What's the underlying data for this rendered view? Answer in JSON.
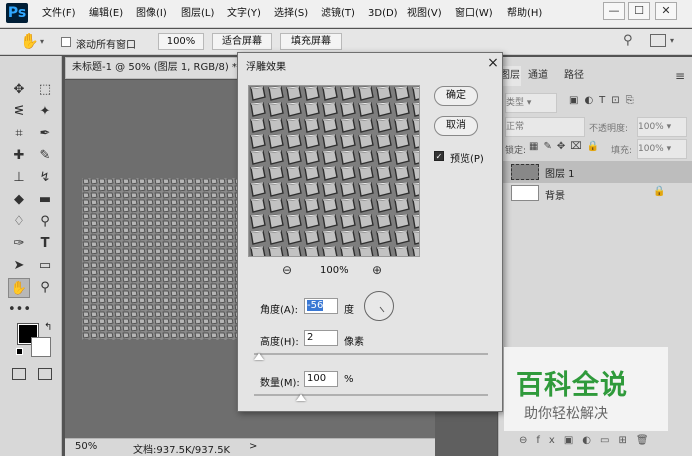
{
  "app": {
    "logo": "Ps"
  },
  "menu": [
    "文件(F)",
    "编辑(E)",
    "图像(I)",
    "图层(L)",
    "文字(Y)",
    "选择(S)",
    "滤镜(T)",
    "3D(D)",
    "视图(V)",
    "窗口(W)",
    "帮助(H)"
  ],
  "window_controls": {
    "minimize": "—",
    "maximize": "☐",
    "close": "✕"
  },
  "options_bar": {
    "scroll_all_label": "滚动所有窗口",
    "zoom_value": "100%",
    "fit_screen": "适合屏幕",
    "fill_screen": "填充屏幕"
  },
  "document": {
    "tab_title": "未标题-1 @ 50% (图层 1, RGB/8) *",
    "zoom": "50%",
    "doc_info": "文档:937.5K/937.5K",
    "status_arrow": ">"
  },
  "panels": {
    "tabs": [
      "图层",
      "通道",
      "路径"
    ],
    "kind_label": "类型",
    "blend_mode": "正常",
    "opacity_label": "不透明度:",
    "opacity_value": "100%",
    "lock_label": "锁定:",
    "fill_label": "填充:",
    "fill_value": "100%",
    "layers": [
      {
        "name": "图层 1",
        "selected": true
      },
      {
        "name": "背景",
        "selected": false
      }
    ]
  },
  "dialog": {
    "title": "浮雕效果",
    "close": "×",
    "ok": "确定",
    "cancel": "取消",
    "preview_label": "预览(P)",
    "preview_checked": true,
    "zoom_value": "100%",
    "angle_label": "角度(A):",
    "angle_value": "-56",
    "angle_unit": "度",
    "height_label": "高度(H):",
    "height_value": "2",
    "height_unit": "像素",
    "height_slider": 0.02,
    "amount_label": "数量(M):",
    "amount_value": "100",
    "amount_unit": "%",
    "amount_slider": 0.2
  },
  "watermark": {
    "title": "百科全说",
    "subtitle": "助你轻松解决"
  }
}
